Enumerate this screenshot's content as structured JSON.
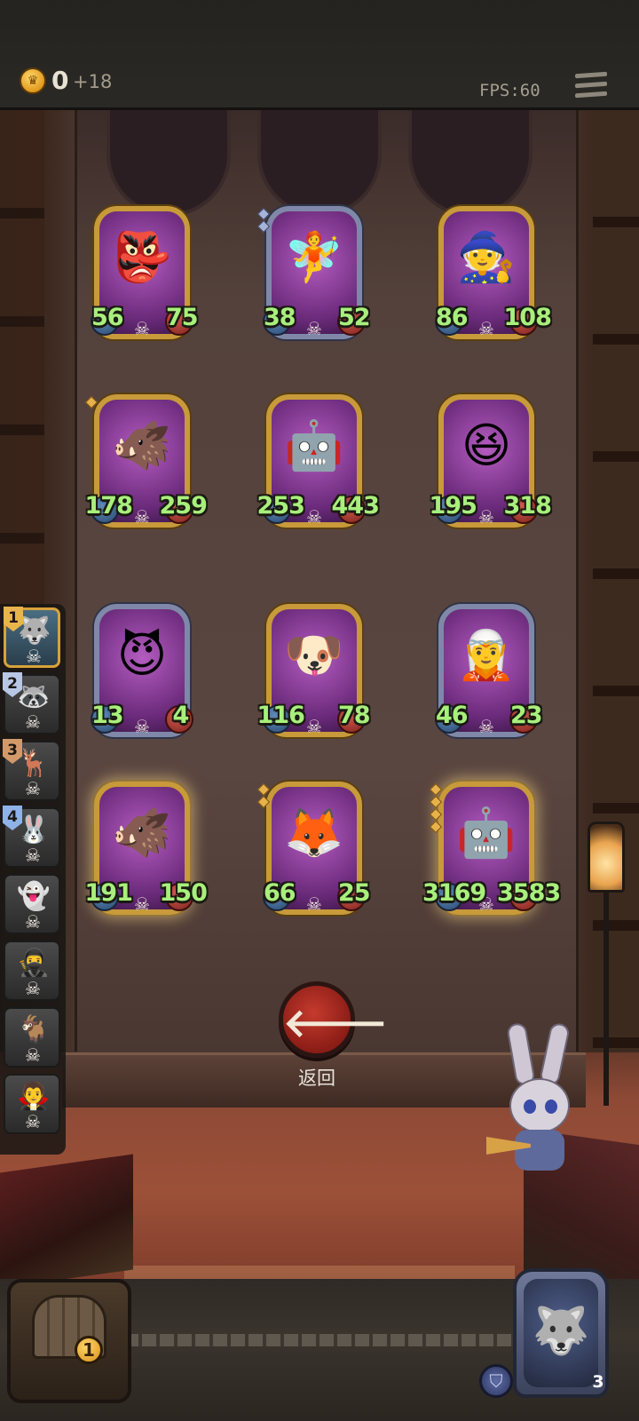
{
  "header": {
    "gold": "0",
    "gold_income": "+18",
    "fps": "FPS:60"
  },
  "cards": [
    {
      "atk": "56",
      "hp": "75",
      "icon": "goblin-mushroom-icon",
      "glyph": "👺",
      "frame": "gold",
      "tier": 0
    },
    {
      "atk": "38",
      "hp": "52",
      "icon": "fairy-icon",
      "glyph": "🧚",
      "frame": "silver",
      "tier": 2
    },
    {
      "atk": "86",
      "hp": "108",
      "icon": "witch-icon",
      "glyph": "🧙",
      "frame": "gold",
      "tier": 0
    },
    {
      "atk": "178",
      "hp": "259",
      "icon": "boar-icon",
      "glyph": "🐗",
      "frame": "gold",
      "tier": 1
    },
    {
      "atk": "253",
      "hp": "443",
      "icon": "armored-knight-icon",
      "glyph": "🤖",
      "frame": "gold",
      "tier": 0
    },
    {
      "atk": "195",
      "hp": "318",
      "icon": "red-ogre-icon",
      "glyph": "😆",
      "frame": "gold",
      "tier": 0
    },
    {
      "atk": "13",
      "hp": "4",
      "icon": "demon-elf-icon",
      "glyph": "😈",
      "frame": "silver",
      "tier": 0
    },
    {
      "atk": "116",
      "hp": "78",
      "icon": "cow-dog-icon",
      "glyph": "🐶",
      "frame": "gold",
      "tier": 0
    },
    {
      "atk": "46",
      "hp": "23",
      "icon": "wizard-elf-icon",
      "glyph": "🧝",
      "frame": "silver",
      "tier": 0
    },
    {
      "atk": "191",
      "hp": "150",
      "icon": "boar-icon",
      "glyph": "🐗",
      "frame": "gold",
      "tier": 0,
      "glow": true
    },
    {
      "atk": "66",
      "hp": "25",
      "icon": "fox-bard-icon",
      "glyph": "🦊",
      "frame": "gold",
      "tier": 2
    },
    {
      "atk": "3169",
      "hp": "3583",
      "icon": "armored-knight-icon",
      "glyph": "🤖",
      "frame": "gold",
      "tier": 4,
      "glow": true
    }
  ],
  "roster": [
    {
      "rank": "1",
      "rank_style": "gold",
      "icon": "wolf-portrait-icon",
      "active": true
    },
    {
      "rank": "2",
      "rank_style": "silver",
      "icon": "masked-portrait-icon"
    },
    {
      "rank": "3",
      "rank_style": "bronze",
      "icon": "deer-portrait-icon"
    },
    {
      "rank": "4",
      "rank_style": "blue",
      "icon": "rabbit-portrait-icon"
    },
    {
      "rank": "",
      "icon": "ghost-portrait-icon"
    },
    {
      "rank": "",
      "icon": "bandit-portrait-icon"
    },
    {
      "rank": "",
      "icon": "goat-portrait-icon"
    },
    {
      "rank": "",
      "icon": "hooded-portrait-icon"
    }
  ],
  "back_button": {
    "label": "返回",
    "icon": "arrow-left-icon"
  },
  "chest": {
    "count": "1",
    "icon": "chest-icon"
  },
  "hero": {
    "lives": "3",
    "icon": "wolf-hero-icon",
    "shield_icon": "shield-icon",
    "heart_icon": "heart-icon"
  },
  "colors": {
    "stat_text": "#a8ef7c",
    "gold_frame": "#c89a3a",
    "silver_frame": "#7f88a8",
    "back_button": "#c63a2e"
  }
}
